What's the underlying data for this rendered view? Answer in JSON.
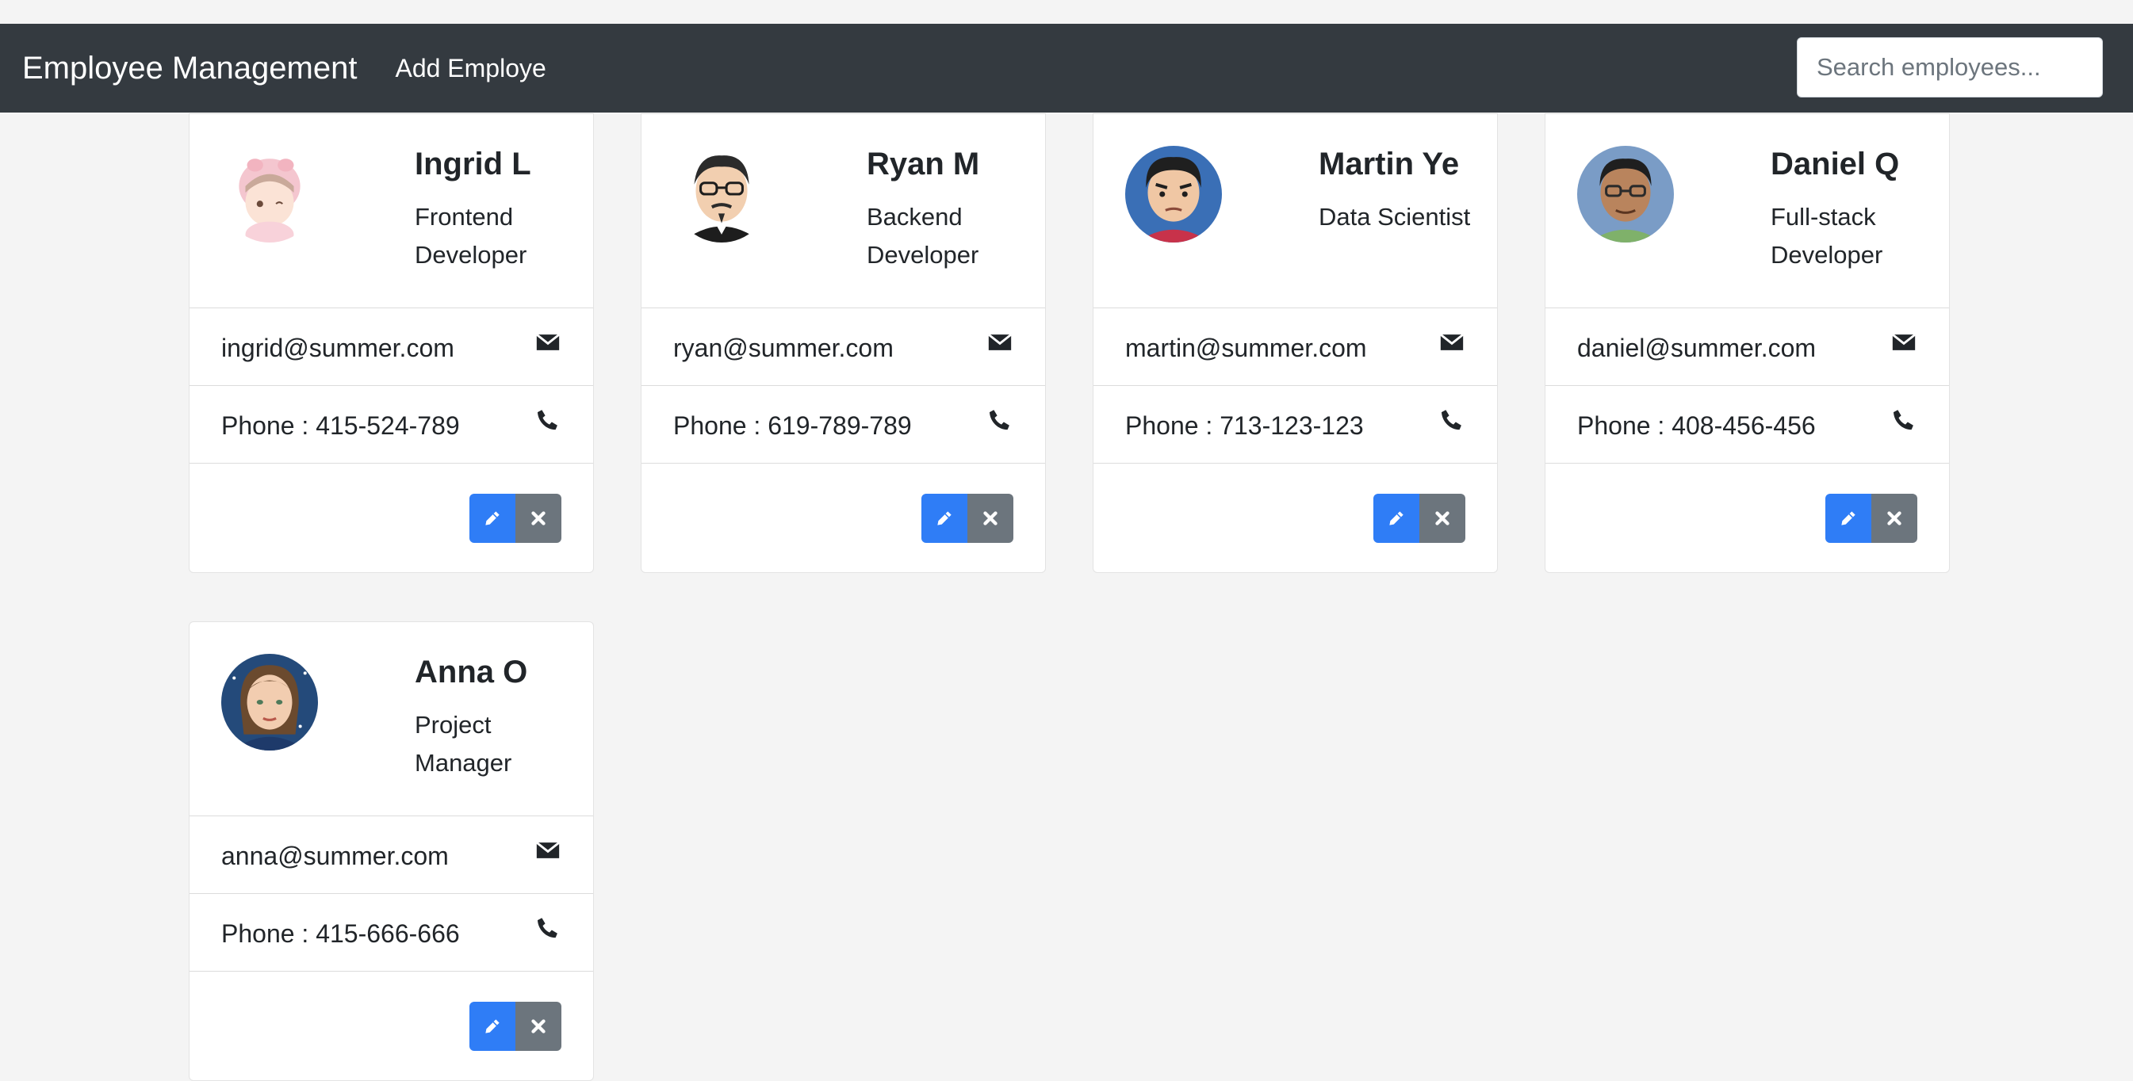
{
  "navbar": {
    "brand": "Employee Management",
    "add_link": "Add Employe",
    "search_placeholder": "Search employees..."
  },
  "colors": {
    "navbar_bg": "#343a40",
    "edit_button": "#2f7df6",
    "delete_button": "#6c757d",
    "page_bg": "#f4f4f4"
  },
  "employees": [
    {
      "name": "Ingrid L",
      "title": "Frontend Developer",
      "email": "ingrid@summer.com",
      "phone": "Phone : 415-524-789"
    },
    {
      "name": "Ryan M",
      "title": "Backend Developer",
      "email": "ryan@summer.com",
      "phone": "Phone : 619-789-789"
    },
    {
      "name": "Martin Ye",
      "title": "Data Scientist",
      "email": "martin@summer.com",
      "phone": "Phone : 713-123-123"
    },
    {
      "name": "Daniel Q",
      "title": "Full-stack Developer",
      "email": "daniel@summer.com",
      "phone": "Phone : 408-456-456"
    },
    {
      "name": "Anna O",
      "title": "Project Manager",
      "email": "anna@summer.com",
      "phone": "Phone : 415-666-666"
    }
  ],
  "icons": {
    "email": "envelope-icon",
    "phone": "phone-icon",
    "edit": "pencil-icon",
    "delete": "close-icon"
  }
}
